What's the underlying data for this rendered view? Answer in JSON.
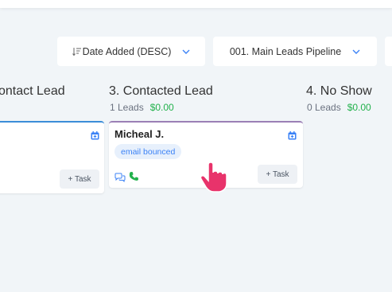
{
  "toolbar": {
    "sort_label": "Date Added (DESC)",
    "pipeline_label": "001. Main Leads Pipeline"
  },
  "columns": [
    {
      "title": "ontact Lead"
    },
    {
      "title": "3. Contacted Lead",
      "count": "1 Leads",
      "amount": "$0.00"
    },
    {
      "title": "4. No Show",
      "count": "0 Leads",
      "amount": "$0.00"
    }
  ],
  "cards": [
    {
      "task_label": "+ Task"
    },
    {
      "name": "Micheal J.",
      "tag": "email bounced",
      "task_label": "+ Task"
    }
  ],
  "icons": {
    "sort": "sort-descending-icon",
    "chevron": "chevron-down-icon",
    "calendar": "calendar-icon",
    "chat": "chat-icon",
    "phone": "phone-icon",
    "cursor": "hand-pointer-icon"
  },
  "colors": {
    "accent": "#3b82f6",
    "money": "#22b14c",
    "card_border_blue": "#3b8dd8",
    "card_border_purple": "#9b7fb5",
    "cursor": "#e8336b"
  }
}
